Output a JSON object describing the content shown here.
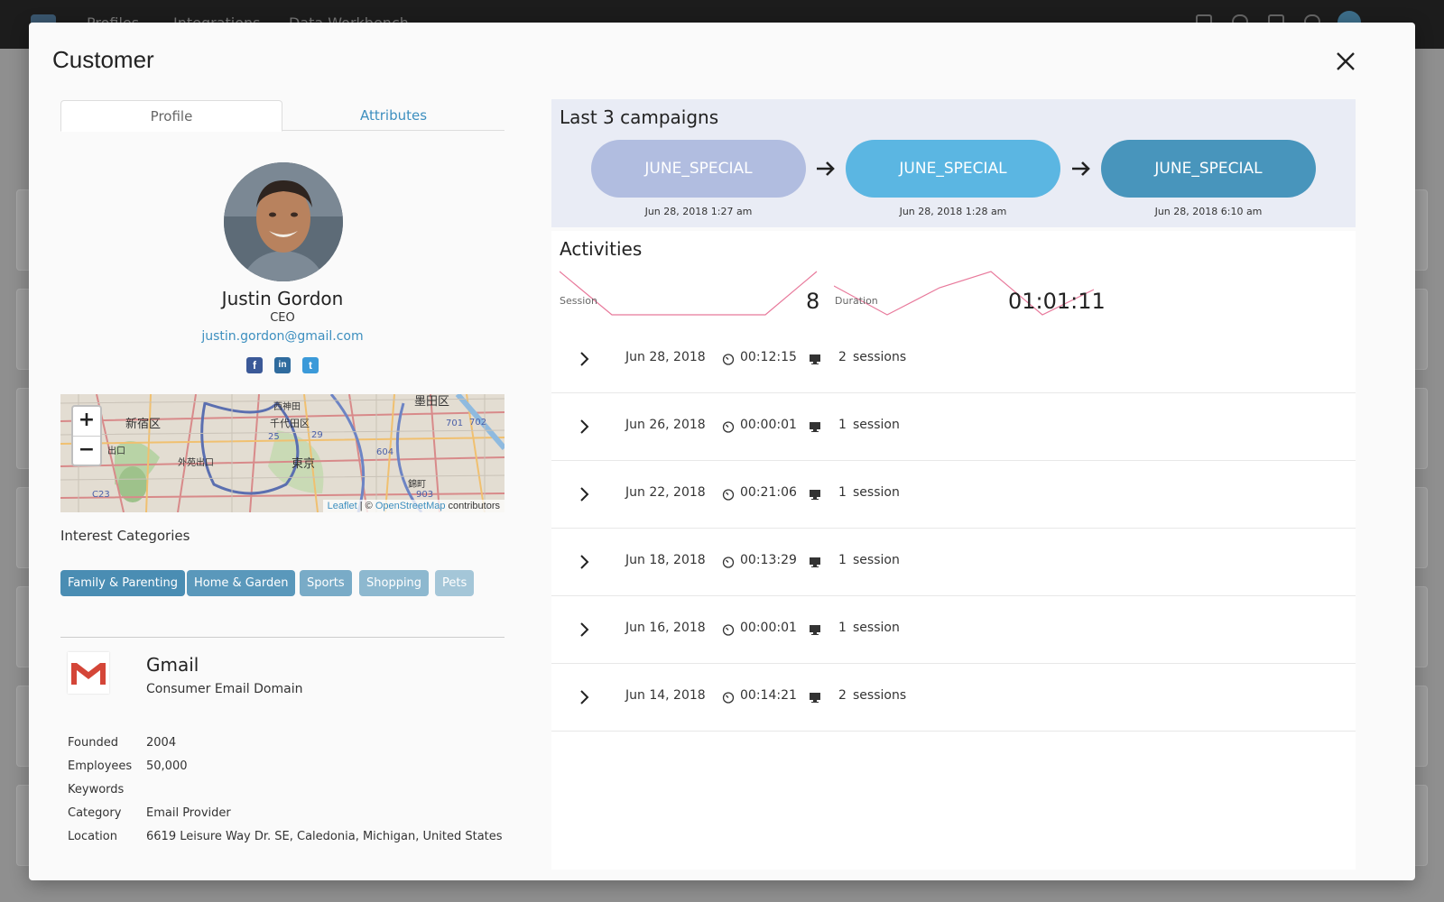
{
  "app_nav": {
    "items": [
      "Profiles",
      "Integrations",
      "Data Workbench"
    ]
  },
  "modal": {
    "title": "Customer"
  },
  "tabs": [
    {
      "label": "Profile",
      "active": true
    },
    {
      "label": "Attributes",
      "active": false
    }
  ],
  "profile": {
    "name": "Justin Gordon",
    "title": "CEO",
    "email": "justin.gordon@gmail.com",
    "socials": [
      {
        "icon": "facebook-icon",
        "glyph": "f",
        "color": "#3b5998"
      },
      {
        "icon": "linkedin-icon",
        "glyph": "in",
        "color": "#0e76a8"
      },
      {
        "icon": "twitter-icon",
        "glyph": "t",
        "color": "#1da1f2"
      }
    ]
  },
  "map": {
    "labels": [
      "新宿区",
      "千代田区",
      "東京",
      "墨田区",
      "西神田",
      "出口",
      "外苑出口",
      "錦町"
    ],
    "route_numbers": [
      "25",
      "29",
      "701",
      "702",
      "604",
      "C23",
      "903"
    ],
    "zoom_in": "+",
    "zoom_out": "−",
    "attribution": {
      "leaflet": "Leaflet",
      "separator": " | © ",
      "osm": "OpenStreetMap",
      "suffix": " contributors"
    }
  },
  "interests": {
    "heading": "Interest Categories",
    "chips": [
      {
        "label": "Family & Parenting",
        "color": "#4a8db3"
      },
      {
        "label": "Home & Garden",
        "color": "#5a98bb"
      },
      {
        "label": "Sports",
        "color": "#79abc7"
      },
      {
        "label": "Shopping",
        "color": "#8db8cf"
      },
      {
        "label": "Pets",
        "color": "#a4c6d8"
      }
    ]
  },
  "company": {
    "name": "Gmail",
    "description": "Consumer Email Domain",
    "fields": [
      {
        "key": "Founded",
        "value": "2004"
      },
      {
        "key": "Employees",
        "value": "50,000"
      },
      {
        "key": "Keywords",
        "value": ""
      },
      {
        "key": "Category",
        "value": "Email Provider"
      },
      {
        "key": "Location",
        "value": "6619 Leisure Way Dr. SE, Caledonia, Michigan, United States"
      }
    ]
  },
  "campaigns": {
    "heading": "Last 3 campaigns",
    "items": [
      {
        "label": "JUNE_SPECIAL",
        "date": "Jun 28, 2018 1:27 am",
        "color": "#b1bde0"
      },
      {
        "label": "JUNE_SPECIAL",
        "date": "Jun 28, 2018 1:28 am",
        "color": "#5bb6e2"
      },
      {
        "label": "JUNE_SPECIAL",
        "date": "Jun 28, 2018 6:10 am",
        "color": "#4895bc"
      }
    ]
  },
  "activities": {
    "heading": "Activities",
    "session_label": "Session",
    "session_value": "8",
    "duration_label": "Duration",
    "duration_value": "01:01:11",
    "accent": "#e8799b",
    "rows": [
      {
        "date": "Jun 28, 2018",
        "duration": "00:12:15",
        "count": "2",
        "unit": "sessions"
      },
      {
        "date": "Jun 26, 2018",
        "duration": "00:00:01",
        "count": "1",
        "unit": "session"
      },
      {
        "date": "Jun 22, 2018",
        "duration": "00:21:06",
        "count": "1",
        "unit": "session"
      },
      {
        "date": "Jun 18, 2018",
        "duration": "00:13:29",
        "count": "1",
        "unit": "session"
      },
      {
        "date": "Jun 16, 2018",
        "duration": "00:00:01",
        "count": "1",
        "unit": "session"
      },
      {
        "date": "Jun 14, 2018",
        "duration": "00:14:21",
        "count": "2",
        "unit": "sessions"
      }
    ]
  }
}
